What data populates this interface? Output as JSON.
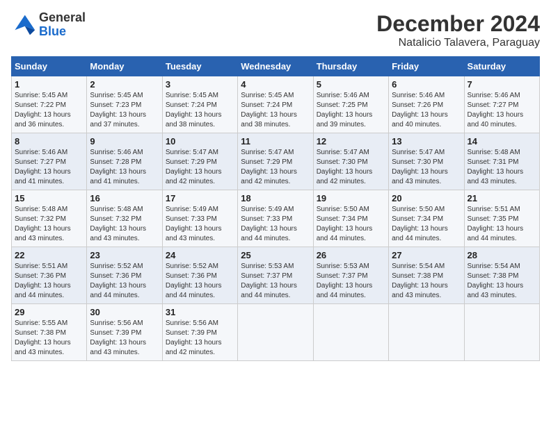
{
  "header": {
    "logo_line1": "General",
    "logo_line2": "Blue",
    "month": "December 2024",
    "location": "Natalicio Talavera, Paraguay"
  },
  "weekdays": [
    "Sunday",
    "Monday",
    "Tuesday",
    "Wednesday",
    "Thursday",
    "Friday",
    "Saturday"
  ],
  "weeks": [
    [
      {
        "day": "1",
        "sunrise": "5:45 AM",
        "sunset": "7:22 PM",
        "daylight": "13 hours and 36 minutes."
      },
      {
        "day": "2",
        "sunrise": "5:45 AM",
        "sunset": "7:23 PM",
        "daylight": "13 hours and 37 minutes."
      },
      {
        "day": "3",
        "sunrise": "5:45 AM",
        "sunset": "7:24 PM",
        "daylight": "13 hours and 38 minutes."
      },
      {
        "day": "4",
        "sunrise": "5:45 AM",
        "sunset": "7:24 PM",
        "daylight": "13 hours and 38 minutes."
      },
      {
        "day": "5",
        "sunrise": "5:46 AM",
        "sunset": "7:25 PM",
        "daylight": "13 hours and 39 minutes."
      },
      {
        "day": "6",
        "sunrise": "5:46 AM",
        "sunset": "7:26 PM",
        "daylight": "13 hours and 40 minutes."
      },
      {
        "day": "7",
        "sunrise": "5:46 AM",
        "sunset": "7:27 PM",
        "daylight": "13 hours and 40 minutes."
      }
    ],
    [
      {
        "day": "8",
        "sunrise": "5:46 AM",
        "sunset": "7:27 PM",
        "daylight": "13 hours and 41 minutes."
      },
      {
        "day": "9",
        "sunrise": "5:46 AM",
        "sunset": "7:28 PM",
        "daylight": "13 hours and 41 minutes."
      },
      {
        "day": "10",
        "sunrise": "5:47 AM",
        "sunset": "7:29 PM",
        "daylight": "13 hours and 42 minutes."
      },
      {
        "day": "11",
        "sunrise": "5:47 AM",
        "sunset": "7:29 PM",
        "daylight": "13 hours and 42 minutes."
      },
      {
        "day": "12",
        "sunrise": "5:47 AM",
        "sunset": "7:30 PM",
        "daylight": "13 hours and 42 minutes."
      },
      {
        "day": "13",
        "sunrise": "5:47 AM",
        "sunset": "7:30 PM",
        "daylight": "13 hours and 43 minutes."
      },
      {
        "day": "14",
        "sunrise": "5:48 AM",
        "sunset": "7:31 PM",
        "daylight": "13 hours and 43 minutes."
      }
    ],
    [
      {
        "day": "15",
        "sunrise": "5:48 AM",
        "sunset": "7:32 PM",
        "daylight": "13 hours and 43 minutes."
      },
      {
        "day": "16",
        "sunrise": "5:48 AM",
        "sunset": "7:32 PM",
        "daylight": "13 hours and 43 minutes."
      },
      {
        "day": "17",
        "sunrise": "5:49 AM",
        "sunset": "7:33 PM",
        "daylight": "13 hours and 43 minutes."
      },
      {
        "day": "18",
        "sunrise": "5:49 AM",
        "sunset": "7:33 PM",
        "daylight": "13 hours and 44 minutes."
      },
      {
        "day": "19",
        "sunrise": "5:50 AM",
        "sunset": "7:34 PM",
        "daylight": "13 hours and 44 minutes."
      },
      {
        "day": "20",
        "sunrise": "5:50 AM",
        "sunset": "7:34 PM",
        "daylight": "13 hours and 44 minutes."
      },
      {
        "day": "21",
        "sunrise": "5:51 AM",
        "sunset": "7:35 PM",
        "daylight": "13 hours and 44 minutes."
      }
    ],
    [
      {
        "day": "22",
        "sunrise": "5:51 AM",
        "sunset": "7:36 PM",
        "daylight": "13 hours and 44 minutes."
      },
      {
        "day": "23",
        "sunrise": "5:52 AM",
        "sunset": "7:36 PM",
        "daylight": "13 hours and 44 minutes."
      },
      {
        "day": "24",
        "sunrise": "5:52 AM",
        "sunset": "7:36 PM",
        "daylight": "13 hours and 44 minutes."
      },
      {
        "day": "25",
        "sunrise": "5:53 AM",
        "sunset": "7:37 PM",
        "daylight": "13 hours and 44 minutes."
      },
      {
        "day": "26",
        "sunrise": "5:53 AM",
        "sunset": "7:37 PM",
        "daylight": "13 hours and 44 minutes."
      },
      {
        "day": "27",
        "sunrise": "5:54 AM",
        "sunset": "7:38 PM",
        "daylight": "13 hours and 43 minutes."
      },
      {
        "day": "28",
        "sunrise": "5:54 AM",
        "sunset": "7:38 PM",
        "daylight": "13 hours and 43 minutes."
      }
    ],
    [
      {
        "day": "29",
        "sunrise": "5:55 AM",
        "sunset": "7:38 PM",
        "daylight": "13 hours and 43 minutes."
      },
      {
        "day": "30",
        "sunrise": "5:56 AM",
        "sunset": "7:39 PM",
        "daylight": "13 hours and 43 minutes."
      },
      {
        "day": "31",
        "sunrise": "5:56 AM",
        "sunset": "7:39 PM",
        "daylight": "13 hours and 42 minutes."
      },
      null,
      null,
      null,
      null
    ]
  ]
}
